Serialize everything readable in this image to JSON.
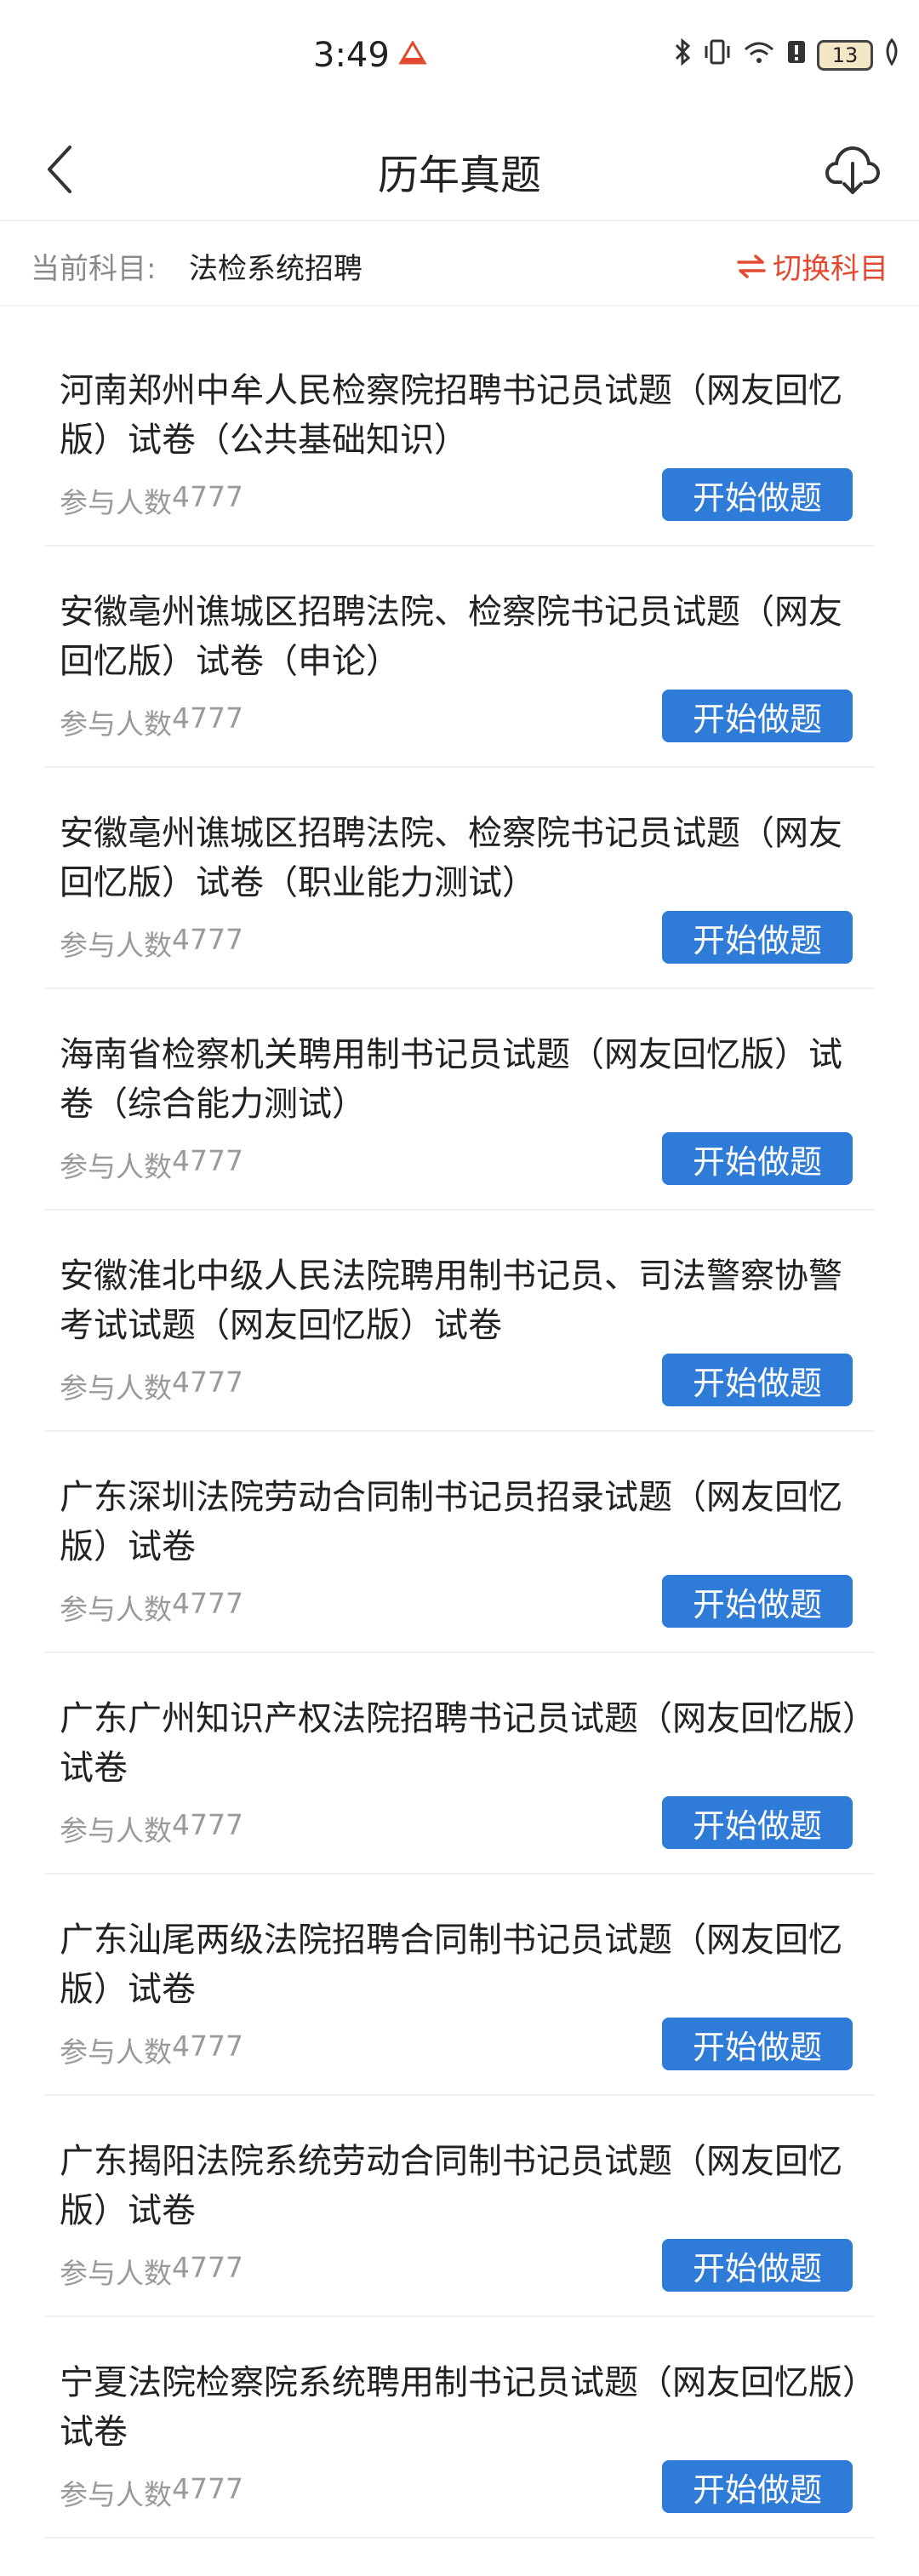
{
  "status_bar": {
    "time": "3:49",
    "battery": "13"
  },
  "header": {
    "title": "历年真题"
  },
  "subject": {
    "label": "当前科目:",
    "value": "法检系统招聘",
    "switch_label": "切换科目"
  },
  "exams": [
    {
      "title": "河南郑州中牟人民检察院招聘书记员试题（网友回忆版）试卷（公共基础知识）",
      "participants_label": "参与人数",
      "participants_count": "4777",
      "button_label": "开始做题"
    },
    {
      "title": "安徽亳州谯城区招聘法院、检察院书记员试题（网友回忆版）试卷（申论）",
      "participants_label": "参与人数",
      "participants_count": "4777",
      "button_label": "开始做题"
    },
    {
      "title": "安徽亳州谯城区招聘法院、检察院书记员试题（网友回忆版）试卷（职业能力测试）",
      "participants_label": "参与人数",
      "participants_count": "4777",
      "button_label": "开始做题"
    },
    {
      "title": "海南省检察机关聘用制书记员试题（网友回忆版）试卷（综合能力测试）",
      "participants_label": "参与人数",
      "participants_count": "4777",
      "button_label": "开始做题"
    },
    {
      "title": "安徽淮北中级人民法院聘用制书记员、司法警察协警考试试题（网友回忆版）试卷",
      "participants_label": "参与人数",
      "participants_count": "4777",
      "button_label": "开始做题"
    },
    {
      "title": "广东深圳法院劳动合同制书记员招录试题（网友回忆版）试卷",
      "participants_label": "参与人数",
      "participants_count": "4777",
      "button_label": "开始做题"
    },
    {
      "title": "广东广州知识产权法院招聘书记员试题（网友回忆版）试卷",
      "participants_label": "参与人数",
      "participants_count": "4777",
      "button_label": "开始做题"
    },
    {
      "title": "广东汕尾两级法院招聘合同制书记员试题（网友回忆版）试卷",
      "participants_label": "参与人数",
      "participants_count": "4777",
      "button_label": "开始做题"
    },
    {
      "title": "广东揭阳法院系统劳动合同制书记员试题（网友回忆版）试卷",
      "participants_label": "参与人数",
      "participants_count": "4777",
      "button_label": "开始做题"
    },
    {
      "title": "宁夏法院检察院系统聘用制书记员试题（网友回忆版）试卷",
      "participants_label": "参与人数",
      "participants_count": "4777",
      "button_label": "开始做题"
    }
  ],
  "colors": {
    "accent_blue": "#2f7bd8",
    "switch_red": "#e2492f"
  }
}
